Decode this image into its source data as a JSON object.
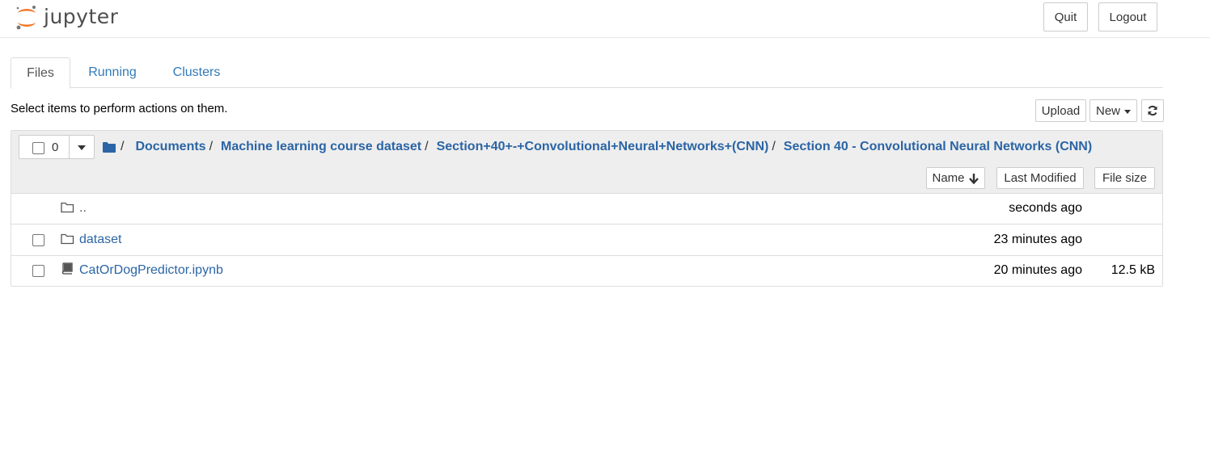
{
  "app": {
    "logo_text": "jupyter",
    "quit_label": "Quit",
    "logout_label": "Logout"
  },
  "tabs": [
    {
      "label": "Files",
      "active": true
    },
    {
      "label": "Running",
      "active": false
    },
    {
      "label": "Clusters",
      "active": false
    }
  ],
  "hint": "Select items to perform actions on them.",
  "toolbar": {
    "upload_label": "Upload",
    "new_label": "New",
    "refresh_icon": "refresh-icon"
  },
  "selection": {
    "count": "0"
  },
  "breadcrumb": [
    {
      "label": "Documents"
    },
    {
      "label": "Machine learning course dataset"
    },
    {
      "label": "Section+40+-+Convolutional+Neural+Networks+(CNN)"
    },
    {
      "label": "Section 40 - Convolutional Neural Networks (CNN)"
    }
  ],
  "columns": {
    "name": "Name",
    "last_modified": "Last Modified",
    "file_size": "File size"
  },
  "files": [
    {
      "name": "..",
      "type": "folder",
      "modified": "seconds ago",
      "size": ""
    },
    {
      "name": "dataset",
      "type": "folder",
      "modified": "23 minutes ago",
      "size": ""
    },
    {
      "name": "CatOrDogPredictor.ipynb",
      "type": "notebook",
      "modified": "20 minutes ago",
      "size": "12.5 kB"
    }
  ],
  "colors": {
    "link": "#2b65a5",
    "logo_orange": "#f37726",
    "panel_header": "#eeeeee"
  }
}
